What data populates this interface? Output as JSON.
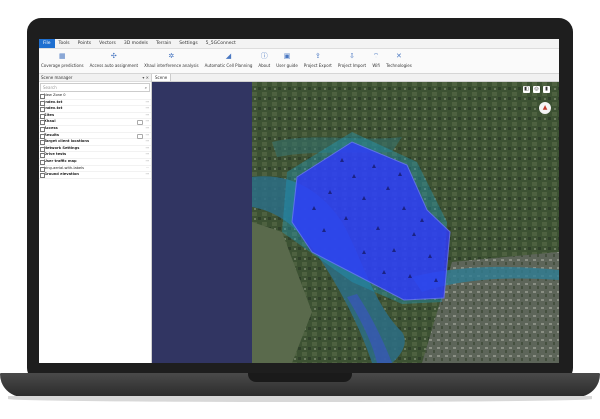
{
  "menu": [
    "File",
    "Tools",
    "Points",
    "Vectors",
    "3D models",
    "Terrain",
    "Settings",
    "5_5GConnect"
  ],
  "ribbon": [
    {
      "label": "Coverage predictions",
      "icon": "coverage-icon",
      "glyph": "▦"
    },
    {
      "label": "Access auto assignment",
      "icon": "auto-assign-icon",
      "glyph": "✣"
    },
    {
      "label": "Xhaul interference analysis",
      "icon": "interference-icon",
      "glyph": "✲"
    },
    {
      "label": "Automatic Cell Planning",
      "icon": "cell-planning-icon",
      "glyph": "◢"
    },
    {
      "label": "About",
      "icon": "info-icon",
      "glyph": "ⓘ"
    },
    {
      "label": "User guide",
      "icon": "guide-icon",
      "glyph": "▣"
    },
    {
      "label": "Project Export",
      "icon": "export-icon",
      "glyph": "⇪"
    },
    {
      "label": "Project Import",
      "icon": "import-icon",
      "glyph": "⇩"
    },
    {
      "label": "Wifi",
      "icon": "wifi-icon",
      "glyph": "⌔"
    },
    {
      "label": "Technologies",
      "icon": "technologies-icon",
      "glyph": "✕"
    }
  ],
  "sidebar": {
    "title": "Scene manager",
    "search_placeholder": "Search",
    "items": [
      {
        "label": "New Zone 0",
        "bold": false
      },
      {
        "label": "Index.txt",
        "bold": true
      },
      {
        "label": "Index.txt",
        "bold": true
      },
      {
        "label": "Sites",
        "bold": true
      },
      {
        "label": "Xhaul",
        "bold": true
      },
      {
        "label": "Access",
        "bold": true
      },
      {
        "label": "Results",
        "bold": true
      },
      {
        "label": "Target client locations",
        "bold": true
      },
      {
        "label": "Network Settings",
        "bold": true
      },
      {
        "label": "Drive tests",
        "bold": true
      },
      {
        "label": "User traffic map",
        "bold": true
      },
      {
        "label": "bing-aerial-with-labels",
        "bold": false
      },
      {
        "label": "Ground elevation",
        "bold": true
      }
    ]
  },
  "scene_tab": "Scene",
  "colors": {
    "accent": "#1e6fd0",
    "coverage": "#2f39ff",
    "navy_panel": "#313562",
    "map_dark": "#394a36"
  }
}
